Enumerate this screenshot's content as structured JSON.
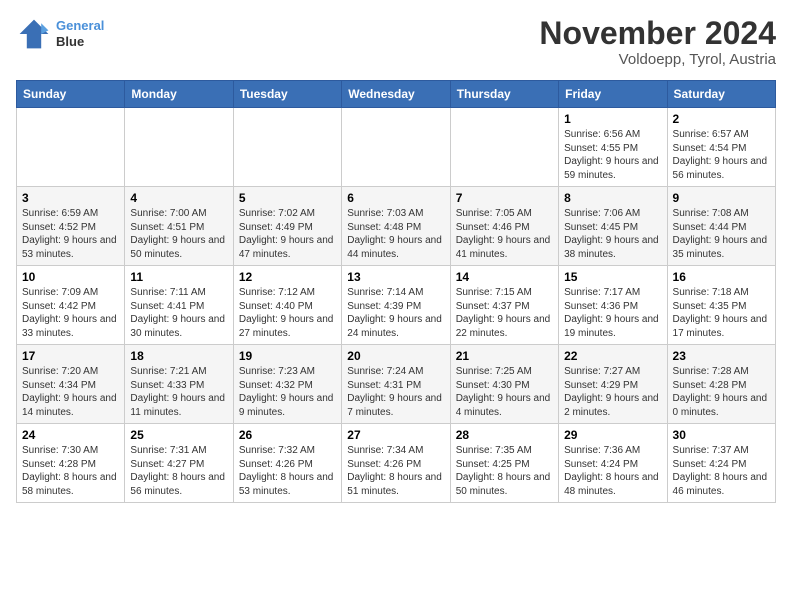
{
  "header": {
    "logo_line1": "General",
    "logo_line2": "Blue",
    "month": "November 2024",
    "location": "Voldoepp, Tyrol, Austria"
  },
  "weekdays": [
    "Sunday",
    "Monday",
    "Tuesday",
    "Wednesday",
    "Thursday",
    "Friday",
    "Saturday"
  ],
  "weeks": [
    [
      {
        "day": "",
        "info": ""
      },
      {
        "day": "",
        "info": ""
      },
      {
        "day": "",
        "info": ""
      },
      {
        "day": "",
        "info": ""
      },
      {
        "day": "",
        "info": ""
      },
      {
        "day": "1",
        "info": "Sunrise: 6:56 AM\nSunset: 4:55 PM\nDaylight: 9 hours and 59 minutes."
      },
      {
        "day": "2",
        "info": "Sunrise: 6:57 AM\nSunset: 4:54 PM\nDaylight: 9 hours and 56 minutes."
      }
    ],
    [
      {
        "day": "3",
        "info": "Sunrise: 6:59 AM\nSunset: 4:52 PM\nDaylight: 9 hours and 53 minutes."
      },
      {
        "day": "4",
        "info": "Sunrise: 7:00 AM\nSunset: 4:51 PM\nDaylight: 9 hours and 50 minutes."
      },
      {
        "day": "5",
        "info": "Sunrise: 7:02 AM\nSunset: 4:49 PM\nDaylight: 9 hours and 47 minutes."
      },
      {
        "day": "6",
        "info": "Sunrise: 7:03 AM\nSunset: 4:48 PM\nDaylight: 9 hours and 44 minutes."
      },
      {
        "day": "7",
        "info": "Sunrise: 7:05 AM\nSunset: 4:46 PM\nDaylight: 9 hours and 41 minutes."
      },
      {
        "day": "8",
        "info": "Sunrise: 7:06 AM\nSunset: 4:45 PM\nDaylight: 9 hours and 38 minutes."
      },
      {
        "day": "9",
        "info": "Sunrise: 7:08 AM\nSunset: 4:44 PM\nDaylight: 9 hours and 35 minutes."
      }
    ],
    [
      {
        "day": "10",
        "info": "Sunrise: 7:09 AM\nSunset: 4:42 PM\nDaylight: 9 hours and 33 minutes."
      },
      {
        "day": "11",
        "info": "Sunrise: 7:11 AM\nSunset: 4:41 PM\nDaylight: 9 hours and 30 minutes."
      },
      {
        "day": "12",
        "info": "Sunrise: 7:12 AM\nSunset: 4:40 PM\nDaylight: 9 hours and 27 minutes."
      },
      {
        "day": "13",
        "info": "Sunrise: 7:14 AM\nSunset: 4:39 PM\nDaylight: 9 hours and 24 minutes."
      },
      {
        "day": "14",
        "info": "Sunrise: 7:15 AM\nSunset: 4:37 PM\nDaylight: 9 hours and 22 minutes."
      },
      {
        "day": "15",
        "info": "Sunrise: 7:17 AM\nSunset: 4:36 PM\nDaylight: 9 hours and 19 minutes."
      },
      {
        "day": "16",
        "info": "Sunrise: 7:18 AM\nSunset: 4:35 PM\nDaylight: 9 hours and 17 minutes."
      }
    ],
    [
      {
        "day": "17",
        "info": "Sunrise: 7:20 AM\nSunset: 4:34 PM\nDaylight: 9 hours and 14 minutes."
      },
      {
        "day": "18",
        "info": "Sunrise: 7:21 AM\nSunset: 4:33 PM\nDaylight: 9 hours and 11 minutes."
      },
      {
        "day": "19",
        "info": "Sunrise: 7:23 AM\nSunset: 4:32 PM\nDaylight: 9 hours and 9 minutes."
      },
      {
        "day": "20",
        "info": "Sunrise: 7:24 AM\nSunset: 4:31 PM\nDaylight: 9 hours and 7 minutes."
      },
      {
        "day": "21",
        "info": "Sunrise: 7:25 AM\nSunset: 4:30 PM\nDaylight: 9 hours and 4 minutes."
      },
      {
        "day": "22",
        "info": "Sunrise: 7:27 AM\nSunset: 4:29 PM\nDaylight: 9 hours and 2 minutes."
      },
      {
        "day": "23",
        "info": "Sunrise: 7:28 AM\nSunset: 4:28 PM\nDaylight: 9 hours and 0 minutes."
      }
    ],
    [
      {
        "day": "24",
        "info": "Sunrise: 7:30 AM\nSunset: 4:28 PM\nDaylight: 8 hours and 58 minutes."
      },
      {
        "day": "25",
        "info": "Sunrise: 7:31 AM\nSunset: 4:27 PM\nDaylight: 8 hours and 56 minutes."
      },
      {
        "day": "26",
        "info": "Sunrise: 7:32 AM\nSunset: 4:26 PM\nDaylight: 8 hours and 53 minutes."
      },
      {
        "day": "27",
        "info": "Sunrise: 7:34 AM\nSunset: 4:26 PM\nDaylight: 8 hours and 51 minutes."
      },
      {
        "day": "28",
        "info": "Sunrise: 7:35 AM\nSunset: 4:25 PM\nDaylight: 8 hours and 50 minutes."
      },
      {
        "day": "29",
        "info": "Sunrise: 7:36 AM\nSunset: 4:24 PM\nDaylight: 8 hours and 48 minutes."
      },
      {
        "day": "30",
        "info": "Sunrise: 7:37 AM\nSunset: 4:24 PM\nDaylight: 8 hours and 46 minutes."
      }
    ]
  ]
}
